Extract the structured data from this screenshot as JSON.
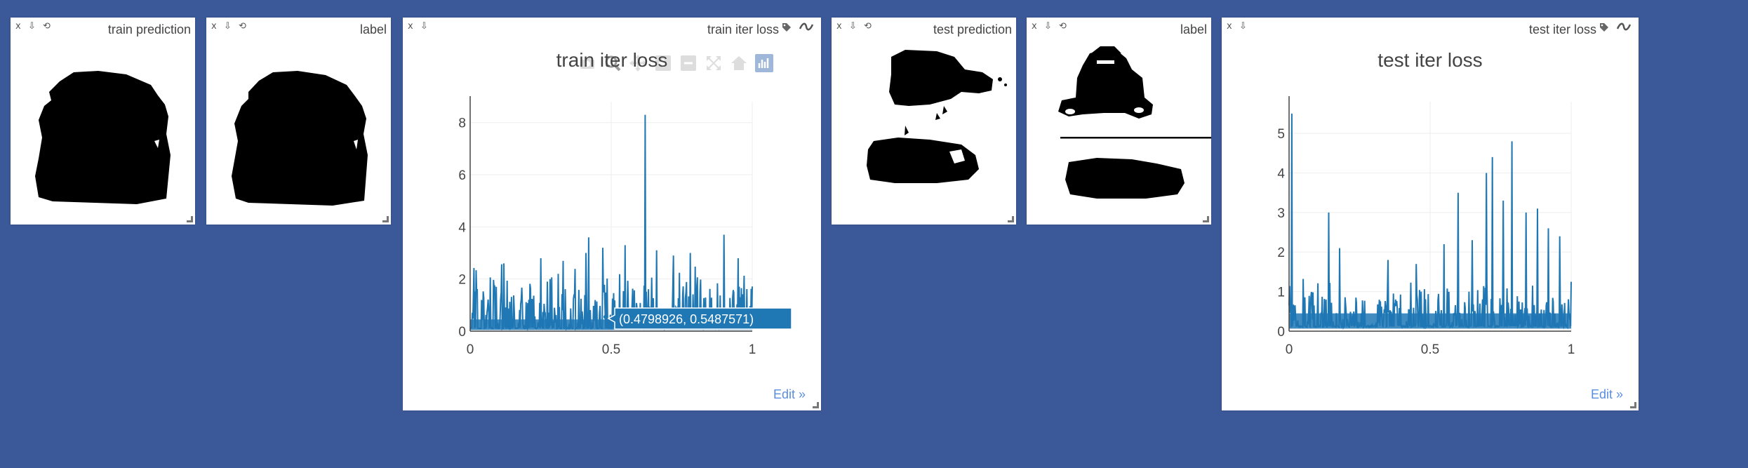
{
  "panels": {
    "train_prediction": {
      "title": "train prediction"
    },
    "label_1": {
      "title": "label"
    },
    "train_iter_loss": {
      "title": "train iter loss",
      "edit_label": "Edit »"
    },
    "test_prediction": {
      "title": "test prediction"
    },
    "label_2": {
      "title": "label"
    },
    "test_iter_loss": {
      "title": "test iter loss",
      "edit_label": "Edit »"
    }
  },
  "controls": {
    "close": "x",
    "download": "⇩",
    "reset": "⟲"
  },
  "hover_label": "(0.4798926, 0.5487571)",
  "modebar_icons": [
    "camera-icon",
    "zoom-icon",
    "pan-icon",
    "zoom-in-icon",
    "zoom-out-icon",
    "autoscale-icon",
    "home-icon",
    "plotly-logo-icon"
  ],
  "colors": {
    "background": "#3b5998",
    "series": "#1f77b4",
    "link": "#5a8de0"
  },
  "chart_data": [
    {
      "type": "line",
      "title": "train iter loss",
      "xlim": [
        0,
        1
      ],
      "ylim": [
        0,
        8.8
      ],
      "x_ticks": [
        "0",
        "0.5",
        "1"
      ],
      "y_ticks": [
        "0",
        "2",
        "4",
        "6",
        "8"
      ],
      "x_tick_values": [
        0,
        0.5,
        1
      ],
      "y_tick_values": [
        0,
        2,
        4,
        6,
        8
      ],
      "grid": true,
      "series": [
        {
          "baseline": 0.1,
          "noise_max": 2.6,
          "spikes": [
            [
              0.12,
              2.6
            ],
            [
              0.25,
              2.8
            ],
            [
              0.33,
              2.7
            ],
            [
              0.41,
              3.0
            ],
            [
              0.42,
              3.6
            ],
            [
              0.47,
              3.2
            ],
            [
              0.5,
              3.1
            ],
            [
              0.55,
              3.3
            ],
            [
              0.62,
              8.3
            ],
            [
              0.66,
              3.1
            ],
            [
              0.72,
              2.9
            ],
            [
              0.78,
              3.0
            ],
            [
              0.9,
              3.7
            ],
            [
              0.95,
              2.8
            ]
          ]
        }
      ],
      "hover_point": [
        0.4798926,
        0.5487571
      ]
    },
    {
      "type": "line",
      "title": "test iter loss",
      "xlim": [
        0,
        1
      ],
      "ylim": [
        0,
        5.8
      ],
      "x_ticks": [
        "0",
        "0.5",
        "1"
      ],
      "y_ticks": [
        "0",
        "1",
        "2",
        "3",
        "4",
        "5"
      ],
      "x_tick_values": [
        0,
        0.5,
        1
      ],
      "y_tick_values": [
        0,
        1,
        2,
        3,
        4,
        5
      ],
      "grid": true,
      "series": [
        {
          "baseline": 0.1,
          "noise_max": 1.3,
          "spikes": [
            [
              0.01,
              5.5
            ],
            [
              0.14,
              3.0
            ],
            [
              0.18,
              2.1
            ],
            [
              0.35,
              1.8
            ],
            [
              0.45,
              1.7
            ],
            [
              0.5,
              1.9
            ],
            [
              0.55,
              2.2
            ],
            [
              0.6,
              3.5
            ],
            [
              0.65,
              2.3
            ],
            [
              0.7,
              4.0
            ],
            [
              0.72,
              4.4
            ],
            [
              0.76,
              3.3
            ],
            [
              0.79,
              4.8
            ],
            [
              0.84,
              3.0
            ],
            [
              0.88,
              3.1
            ],
            [
              0.92,
              2.6
            ],
            [
              0.96,
              2.4
            ]
          ]
        }
      ]
    }
  ]
}
